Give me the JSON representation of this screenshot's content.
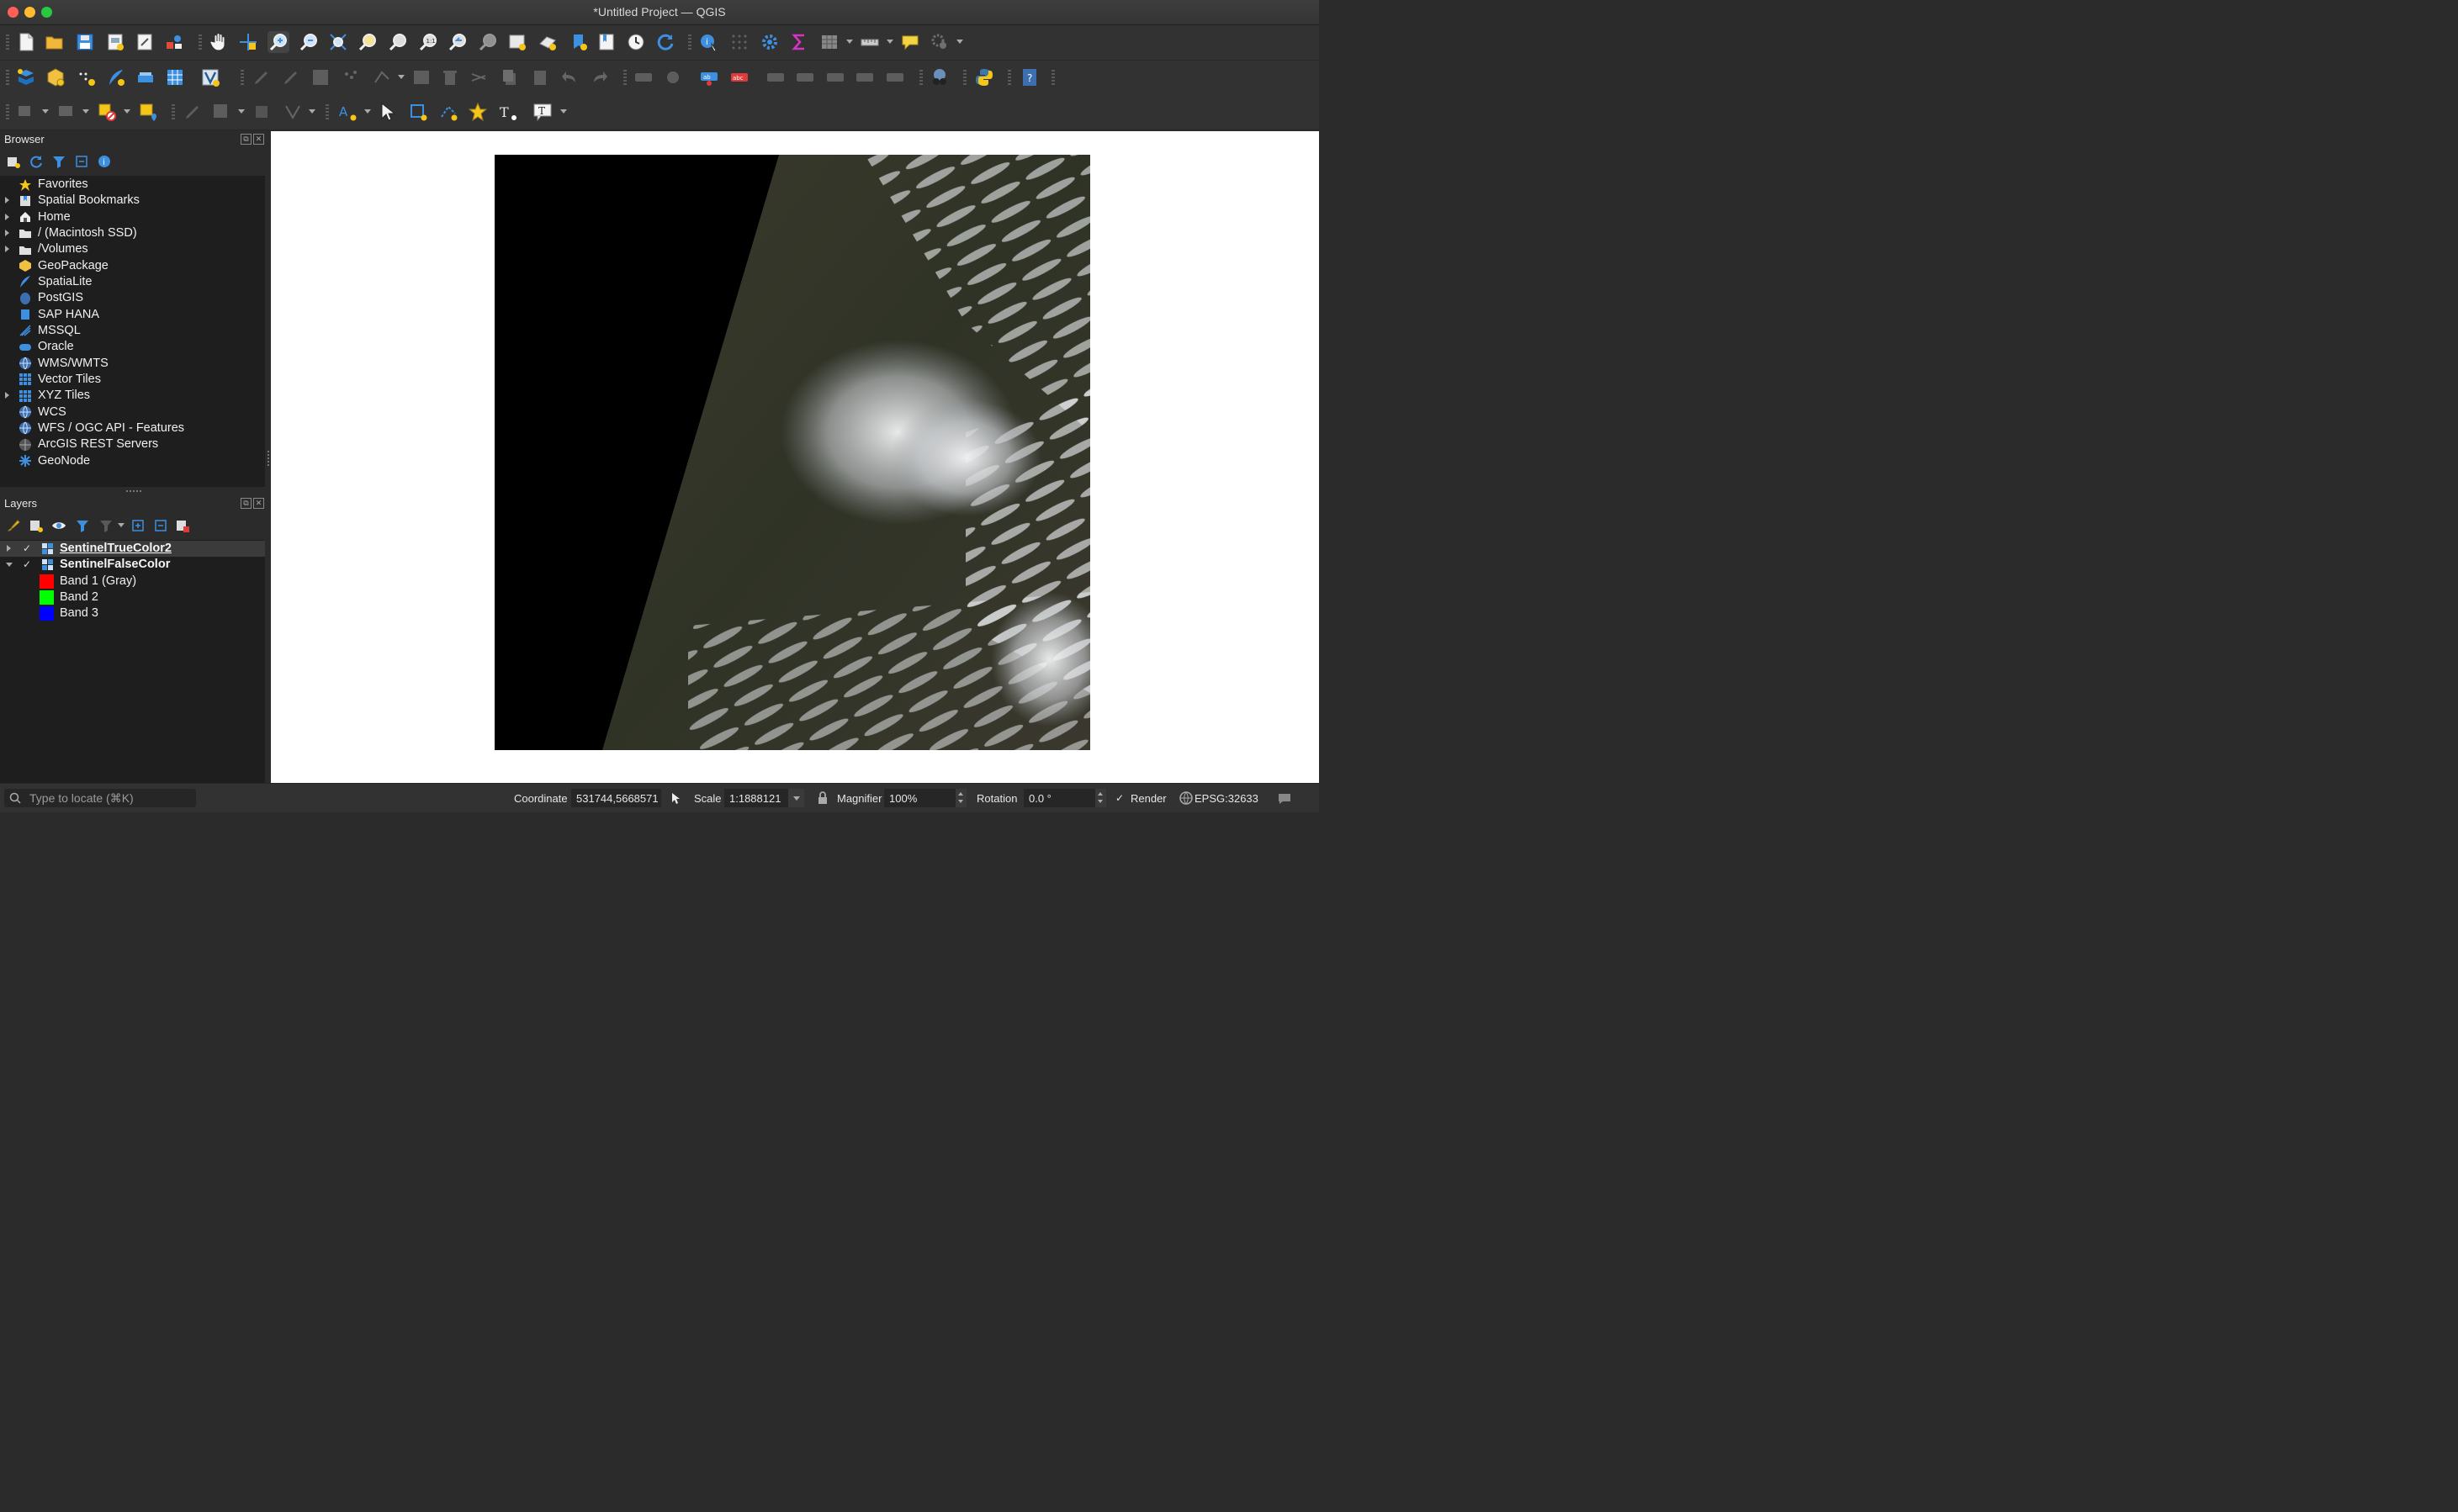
{
  "window": {
    "title": "*Untitled Project — QGIS"
  },
  "browser": {
    "title": "Browser",
    "items": [
      {
        "label": "Favorites",
        "icon": "star-icon",
        "expandable": false
      },
      {
        "label": "Spatial Bookmarks",
        "icon": "bookmarks-icon",
        "expandable": true
      },
      {
        "label": "Home",
        "icon": "home-icon",
        "expandable": true
      },
      {
        "label": "/ (Macintosh SSD)",
        "icon": "folder-icon",
        "expandable": true
      },
      {
        "label": "/Volumes",
        "icon": "folder-icon",
        "expandable": true
      },
      {
        "label": "GeoPackage",
        "icon": "geopackage-icon",
        "expandable": false
      },
      {
        "label": "SpatiaLite",
        "icon": "spatialite-icon",
        "expandable": false
      },
      {
        "label": "PostGIS",
        "icon": "postgis-icon",
        "expandable": false
      },
      {
        "label": "SAP HANA",
        "icon": "saphana-icon",
        "expandable": false
      },
      {
        "label": "MSSQL",
        "icon": "mssql-icon",
        "expandable": false
      },
      {
        "label": "Oracle",
        "icon": "oracle-icon",
        "expandable": false
      },
      {
        "label": "WMS/WMTS",
        "icon": "globe-icon",
        "expandable": false
      },
      {
        "label": "Vector Tiles",
        "icon": "grid-icon",
        "expandable": false
      },
      {
        "label": "XYZ Tiles",
        "icon": "grid-icon",
        "expandable": true
      },
      {
        "label": "WCS",
        "icon": "globe-icon",
        "expandable": false
      },
      {
        "label": "WFS / OGC API - Features",
        "icon": "globe-icon",
        "expandable": false
      },
      {
        "label": "ArcGIS REST Servers",
        "icon": "arcgis-icon",
        "expandable": false
      },
      {
        "label": "GeoNode",
        "icon": "geonode-icon",
        "expandable": false
      }
    ]
  },
  "layers": {
    "title": "Layers",
    "items": [
      {
        "label": "SentinelTrueColor2",
        "checked": true,
        "expanded": false,
        "selected": true
      },
      {
        "label": "SentinelFalseColor",
        "checked": true,
        "expanded": true,
        "selected": false
      }
    ],
    "bands": [
      {
        "label": "Band 1 (Gray)",
        "color": "#ff0000"
      },
      {
        "label": "Band 2",
        "color": "#00ff00"
      },
      {
        "label": "Band 3",
        "color": "#0000ff"
      }
    ]
  },
  "statusbar": {
    "locator_placeholder": "Type to locate (⌘K)",
    "coordinate_label": "Coordinate",
    "coordinate_value": "531744,5668571",
    "scale_label": "Scale",
    "scale_value": "1:1888121",
    "magnifier_label": "Magnifier",
    "magnifier_value": "100%",
    "rotation_label": "Rotation",
    "rotation_value": "0.0 °",
    "render_label": "Render",
    "render_checked": true,
    "crs_label": "EPSG:32633"
  },
  "colors": {
    "accent_blue": "#3d8fe0",
    "star_yellow": "#f5c518",
    "panel_bg": "#1e1e1e",
    "chrome_bg": "#323232"
  }
}
